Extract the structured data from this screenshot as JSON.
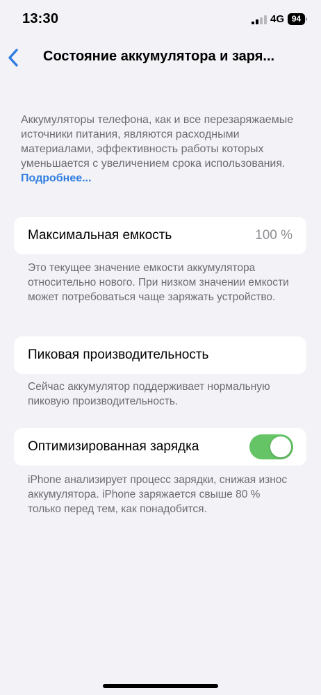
{
  "status_bar": {
    "time": "13:30",
    "network": "4G",
    "battery_level": "94"
  },
  "nav": {
    "title": "Состояние аккумулятора и заря...",
    "back_icon": "chevron-left-icon"
  },
  "intro": {
    "text": "Аккумуляторы телефона, как и все перезаряжаемые источники питания, являются расходными материалами, эффективность работы которых уменьшается с увеличением срока использования.",
    "link": "Подробнее..."
  },
  "max_capacity": {
    "label": "Максимальная емкость",
    "value": "100 %",
    "footnote": "Это текущее значение емкости аккумулятора относительно нового. При низком значении емкости может потребоваться чаще заряжать устройство."
  },
  "peak_performance": {
    "label": "Пиковая производительность",
    "footnote": "Сейчас аккумулятор поддерживает нормальную пиковую производительность."
  },
  "optimized_charging": {
    "label": "Оптимизированная зарядка",
    "enabled": true,
    "footnote": "iPhone анализирует процесс зарядки, снижая износ аккумулятора. iPhone заряжается свыше 80 % только перед тем, как понадобится."
  },
  "colors": {
    "accent": "#2f7de1",
    "toggle_on": "#65c466",
    "background": "#f2f2f7",
    "secondary_text": "#6c6c70"
  }
}
